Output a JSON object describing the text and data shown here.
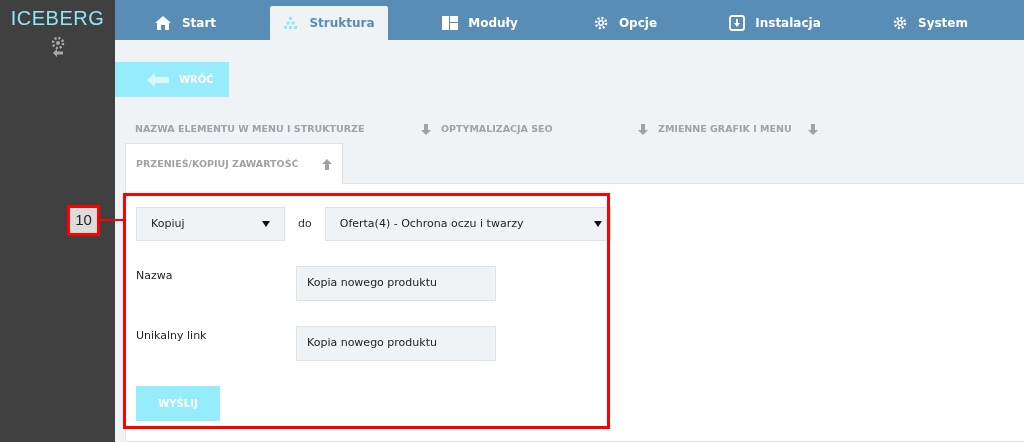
{
  "logo": "ICEBERG",
  "tabs": [
    {
      "label": "Start",
      "kind": "home",
      "selected": false
    },
    {
      "label": "Struktura",
      "kind": "dots",
      "selected": true
    },
    {
      "label": "Moduły",
      "kind": "layout",
      "selected": false
    },
    {
      "label": "Opcje",
      "kind": "gear",
      "selected": false
    },
    {
      "label": "Instalacja",
      "kind": "install",
      "selected": false
    },
    {
      "label": "System",
      "kind": "gear",
      "selected": false
    }
  ],
  "back_button": "WRÓĆ",
  "sections": [
    {
      "label": "NAZWA ELEMENTU W MENU I STRUKTURZE",
      "expanded": false
    },
    {
      "label": "OPTYMALIZACJA SEO",
      "expanded": false
    },
    {
      "label": "ZMIENNE GRAFIK I MENU",
      "expanded": false
    },
    {
      "label": "PRZENIEŚ/KOPIUJ ZAWARTOŚĆ",
      "expanded": true
    }
  ],
  "form": {
    "action": "Kopiuj",
    "connector": "do",
    "target": "Oferta(4) - Ochrona oczu i twarzy",
    "fields": [
      {
        "label": "Nazwa",
        "value": "Kopia nowego produktu"
      },
      {
        "label": "Unikalny link",
        "value": "Kopia nowego produktu"
      }
    ],
    "submit": "WYŚLIJ"
  },
  "callout": {
    "label": "10"
  }
}
